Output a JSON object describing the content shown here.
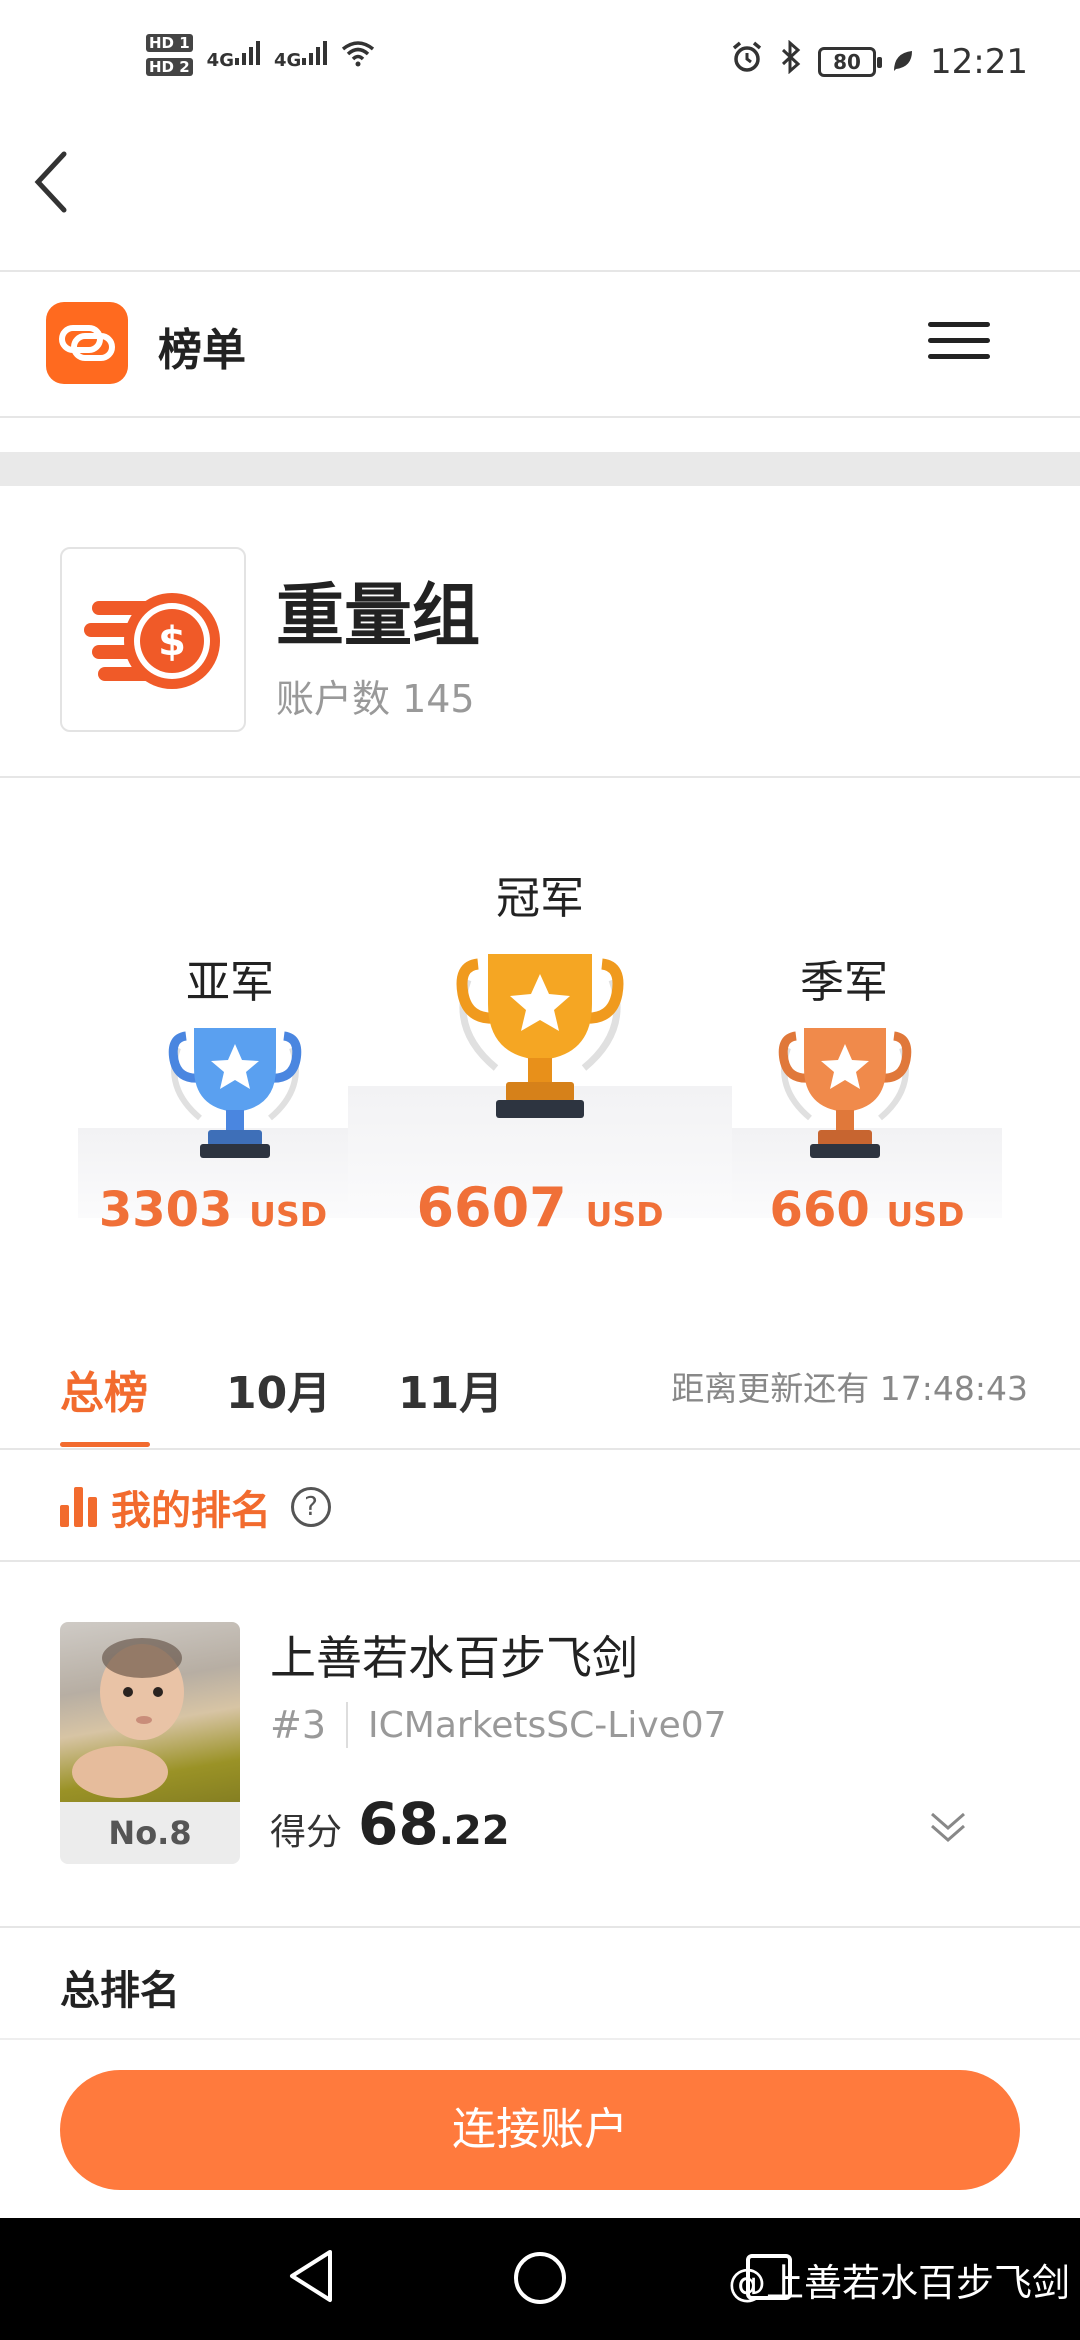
{
  "status_bar": {
    "hd1": "HD 1",
    "hd2": "HD 2",
    "signal1": "4G",
    "signal2": "4G",
    "battery": "80",
    "time": "12:21"
  },
  "app_bar": {
    "title": "榜单"
  },
  "group": {
    "name": "重量组",
    "accounts_label": "账户数 145"
  },
  "podium": {
    "second": {
      "label": "亚军",
      "amount": "3303",
      "unit": "USD"
    },
    "first": {
      "label": "冠军",
      "amount": "6607",
      "unit": "USD"
    },
    "third": {
      "label": "季军",
      "amount": "660",
      "unit": "USD"
    }
  },
  "tabs": {
    "items": [
      "总榜",
      "10月",
      "11月"
    ],
    "active": "总榜",
    "countdown": "距离更新还有 17:48:43"
  },
  "my_rank": {
    "label": "我的排名",
    "help": "?"
  },
  "user": {
    "name": "上善若水百步飞剑",
    "rank_hash": "#3",
    "server": "ICMarketsSC-Live07",
    "position": "No.8",
    "score_label": "得分",
    "score_int": "68",
    "score_dec": ".22"
  },
  "total_rank": {
    "title": "总排名"
  },
  "connect_button": "连接账户",
  "watermark": "@上善若水百步飞剑",
  "colors": {
    "accent": "#ff7a3d",
    "accent_dark": "#f26b2e",
    "gold": "#f5a623",
    "silver_blue": "#5aa0f0",
    "bronze": "#f08a4b"
  }
}
